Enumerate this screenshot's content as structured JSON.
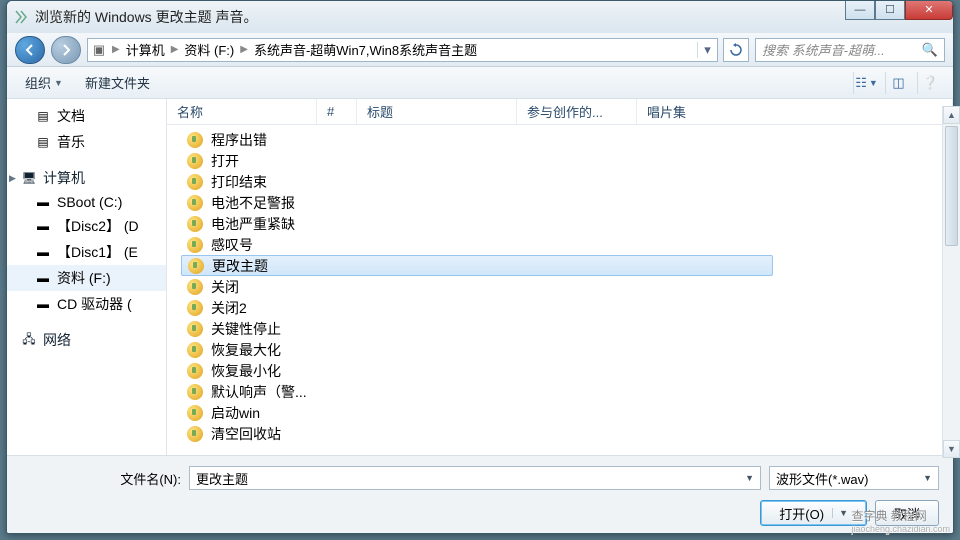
{
  "window": {
    "title": "浏览新的 Windows 更改主题 声音。"
  },
  "nav": {
    "path": [
      "计算机",
      "资料 (F:)",
      "系统声音-超萌Win7,Win8系统声音主题"
    ],
    "search_placeholder": "搜索 系统声音-超萌..."
  },
  "toolbar": {
    "organize": "组织",
    "newfolder": "新建文件夹"
  },
  "sidebar": {
    "docs": "文档",
    "music": "音乐",
    "computer": "计算机",
    "drives": [
      "SBoot (C:)",
      "【Disc2】 (D",
      "【Disc1】 (E",
      "资料 (F:)",
      "CD 驱动器 ("
    ],
    "selected_index": 3,
    "network": "网络"
  },
  "columns": {
    "name": "名称",
    "num": "#",
    "title": "标题",
    "authors": "参与创作的...",
    "album": "唱片集"
  },
  "files": [
    "程序出错",
    "打开",
    "打印结束",
    "电池不足警报",
    "电池严重紧缺",
    "感叹号",
    "更改主题",
    "关闭",
    "关闭2",
    "关键性停止",
    "恢复最大化",
    "恢复最小化",
    "默认响声（警...",
    "启动win",
    "清空回收站"
  ],
  "selected_file_index": 6,
  "footer": {
    "filename_label": "文件名(N):",
    "filename_value": "更改主题",
    "filter": "波形文件(*.wav)",
    "open": "打开(O)",
    "cancel": "取消"
  },
  "watermark": {
    "line1": "查字典 教程网",
    "line2": "jiaocheng.chazidian.com"
  }
}
